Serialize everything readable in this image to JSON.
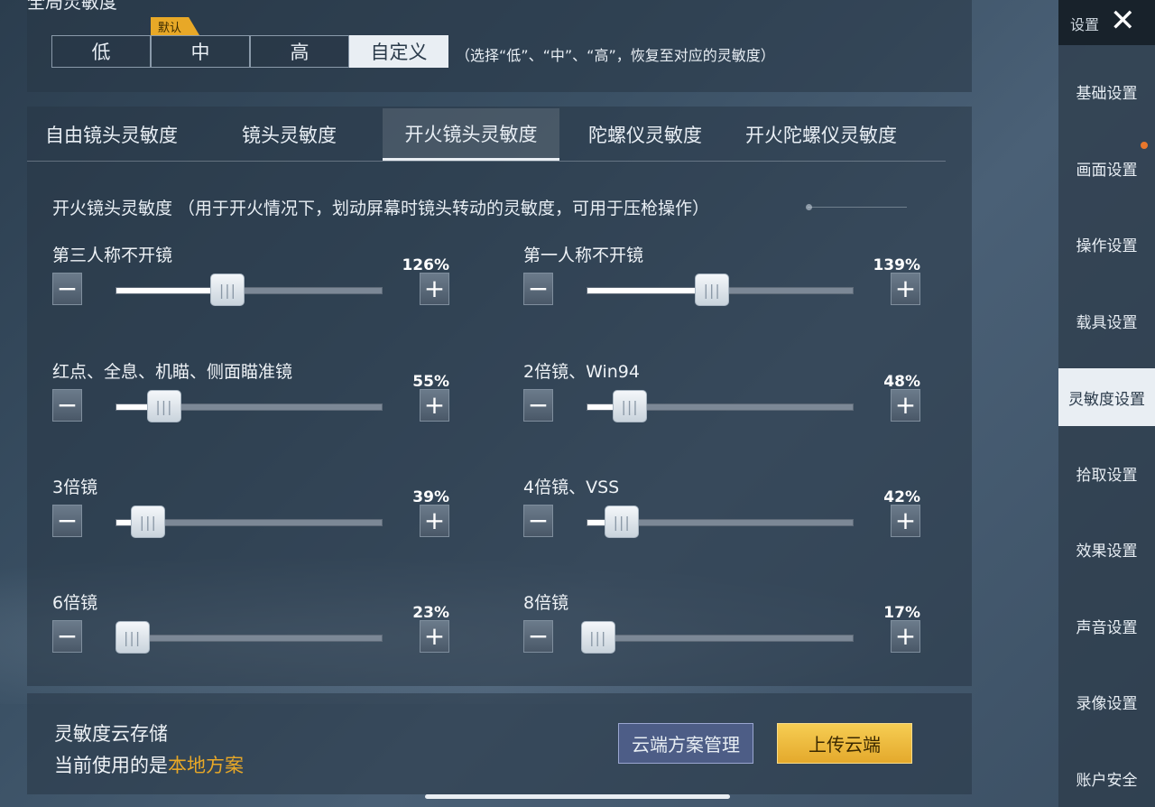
{
  "top": {
    "title": "全局灵敏度",
    "default_badge": "默认",
    "presets": [
      "低",
      "中",
      "高",
      "自定义"
    ],
    "active_preset": "自定义",
    "hint": "（选择“低”、“中”、“高”，恢复至对应的灵敏度）"
  },
  "tabs": [
    "自由镜头灵敏度",
    "镜头灵敏度",
    "开火镜头灵敏度",
    "陀螺仪灵敏度",
    "开火陀螺仪灵敏度"
  ],
  "active_tab": "开火镜头灵敏度",
  "section_desc": "开火镜头灵敏度 （用于开火情况下，划动屏幕时镜头转动的灵敏度，可用于压枪操作）",
  "sliders": [
    {
      "label": "第三人称不开镜",
      "value_text": "126%",
      "fill": 0.42
    },
    {
      "label": "第一人称不开镜",
      "value_text": "139%",
      "fill": 0.47
    },
    {
      "label": "红点、全息、机瞄、侧面瞄准镜",
      "value_text": "55%",
      "fill": 0.18
    },
    {
      "label": "2倍镜、Win94",
      "value_text": "48%",
      "fill": 0.16
    },
    {
      "label": "3倍镜",
      "value_text": "39%",
      "fill": 0.12
    },
    {
      "label": "4倍镜、VSS",
      "value_text": "42%",
      "fill": 0.13
    },
    {
      "label": "6倍镜",
      "value_text": "23%",
      "fill": 0.06
    },
    {
      "label": "8倍镜",
      "value_text": "17%",
      "fill": 0.04
    }
  ],
  "cloud": {
    "title": "灵敏度云存储",
    "current_prefix": "当前使用的是",
    "current_scheme": "本地方案",
    "manage_label": "云端方案管理",
    "upload_label": "上传云端"
  },
  "sidebar": {
    "header": "设置",
    "items": [
      "基础设置",
      "画面设置",
      "操作设置",
      "载具设置",
      "灵敏度设置",
      "拾取设置",
      "效果设置",
      "声音设置",
      "录像设置",
      "账户安全"
    ],
    "active": "灵敏度设置"
  },
  "colors": {
    "accent": "#e8a827",
    "active_bg": "#e9eef3"
  }
}
